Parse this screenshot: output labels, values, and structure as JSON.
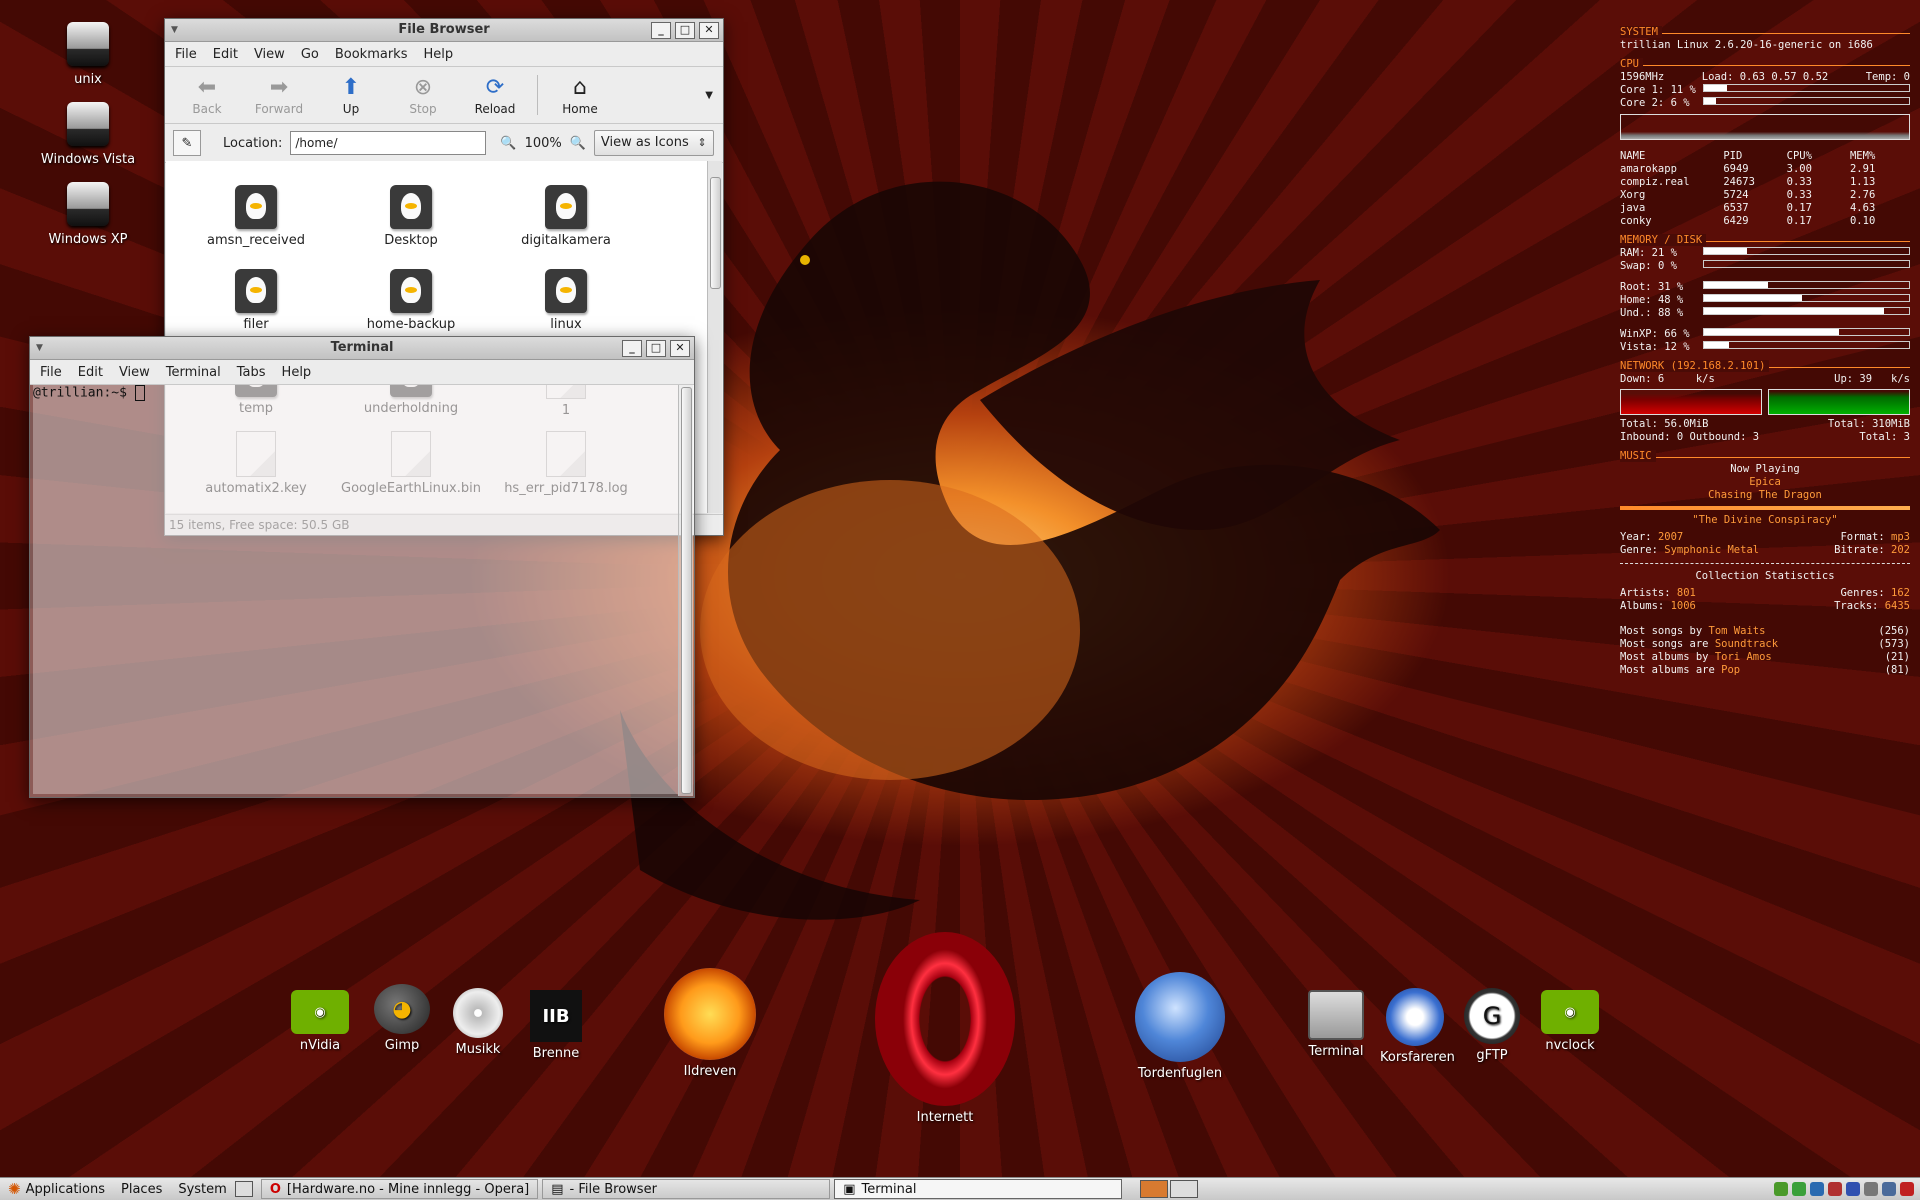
{
  "desktop_icons": [
    {
      "label": "unix"
    },
    {
      "label": "Windows Vista"
    },
    {
      "label": "Windows XP"
    }
  ],
  "file_browser": {
    "title": "File Browser",
    "menu": [
      "File",
      "Edit",
      "View",
      "Go",
      "Bookmarks",
      "Help"
    ],
    "toolbar": {
      "back": "Back",
      "forward": "Forward",
      "up": "Up",
      "stop": "Stop",
      "reload": "Reload",
      "home": "Home"
    },
    "location_label": "Location:",
    "location_value": "/home/",
    "zoom": "100%",
    "view_mode": "View as Icons",
    "items": [
      "amsn_received",
      "Desktop",
      "digitalkamera",
      "filer",
      "home-backup",
      "linux",
      "temp",
      "underholdning",
      "1",
      "automatix2.key",
      "GoogleEarthLinux.bin",
      "hs_err_pid7178.log"
    ],
    "status": "15 items, Free space: 50.5 GB"
  },
  "terminal": {
    "title": "Terminal",
    "menu": [
      "File",
      "Edit",
      "View",
      "Terminal",
      "Tabs",
      "Help"
    ],
    "prompt": "@trillian:~$"
  },
  "dock": [
    {
      "label": "nVidia"
    },
    {
      "label": "Gimp"
    },
    {
      "label": "Musikk"
    },
    {
      "label": "Brenne"
    },
    {
      "label": "Ildreven"
    },
    {
      "label": "Internett"
    },
    {
      "label": "Tordenfuglen"
    },
    {
      "label": "Terminal"
    },
    {
      "label": "Korsfareren"
    },
    {
      "label": "gFTP"
    },
    {
      "label": "nvclock"
    }
  ],
  "conky": {
    "system_header": "SYSTEM",
    "system_line": "trillian Linux 2.6.20-16-generic on i686",
    "cpu_header": "CPU",
    "cpu_freq": "1596MHz",
    "cpu_load": "Load: 0.63 0.57 0.52",
    "cpu_temp": "Temp: 0",
    "cores": [
      {
        "label": "Core 1:",
        "value": "11 %",
        "fraction": 0.11
      },
      {
        "label": "Core 2:",
        "value": "6  %",
        "fraction": 0.06
      }
    ],
    "proc_headers": [
      "NAME",
      "PID",
      "CPU%",
      "MEM%"
    ],
    "processes": [
      [
        "amarokapp",
        "6949",
        "3.00",
        "2.91"
      ],
      [
        "compiz.real",
        "24673",
        "0.33",
        "1.13"
      ],
      [
        "Xorg",
        "5724",
        "0.33",
        "2.76"
      ],
      [
        "java",
        "6537",
        "0.17",
        "4.63"
      ],
      [
        "conky",
        "6429",
        "0.17",
        "0.10"
      ]
    ],
    "mem_header": "MEMORY / DISK",
    "mem": [
      {
        "label": "RAM:",
        "value": "21 %",
        "fraction": 0.21
      },
      {
        "label": "Swap:",
        "value": "0  %",
        "fraction": 0.0
      }
    ],
    "disks": [
      {
        "label": "Root:",
        "value": "31 %",
        "fraction": 0.31
      },
      {
        "label": "Home:",
        "value": "48 %",
        "fraction": 0.48
      },
      {
        "label": "Und.:",
        "value": "88 %",
        "fraction": 0.88
      }
    ],
    "win_disks": [
      {
        "label": "WinXP:",
        "value": "66 %",
        "fraction": 0.66
      },
      {
        "label": "Vista:",
        "value": "12 %",
        "fraction": 0.12
      }
    ],
    "net_header": "NETWORK (192.168.2.101)",
    "down": "Down: 6     k/s",
    "up": "Up: 39   k/s",
    "total_down": "Total: 56.0MiB",
    "total_up": "Total: 310MiB",
    "inout": "Inbound: 0 Outbound: 3",
    "total_conn": "Total: 3",
    "music_header": "MUSIC",
    "now_playing": "Now Playing",
    "artist": "Epica",
    "track": "Chasing The Dragon",
    "album": "\"The Divine Conspiracy\"",
    "year_label": "Year:",
    "year": "2007",
    "format_label": "Format:",
    "format": "mp3",
    "genre_label": "Genre:",
    "genre": "Symphonic Metal",
    "bitrate_label": "Bitrate:",
    "bitrate": "202",
    "collection_header": "Collection Statisctics",
    "artists_label": "Artists:",
    "artists": "801",
    "genres_label": "Genres:",
    "genres": "162",
    "albums_label": "Albums:",
    "albums": "1006",
    "tracks_label": "Tracks:",
    "tracks": "6435",
    "stats": [
      {
        "label": "Most songs by",
        "value": "Tom Waits",
        "count": "(256)"
      },
      {
        "label": "Most songs are",
        "value": "Soundtrack",
        "count": "(573)"
      },
      {
        "label": "Most albums by",
        "value": "Tori Amos",
        "count": "(21)"
      },
      {
        "label": "Most albums are",
        "value": "Pop",
        "count": "(81)"
      }
    ]
  },
  "taskbar": {
    "applications": "Applications",
    "places": "Places",
    "system": "System",
    "tasks": [
      {
        "label": "[Hardware.no - Mine innlegg - Opera]"
      },
      {
        "label": "- File Browser"
      },
      {
        "label": "Terminal"
      }
    ]
  }
}
